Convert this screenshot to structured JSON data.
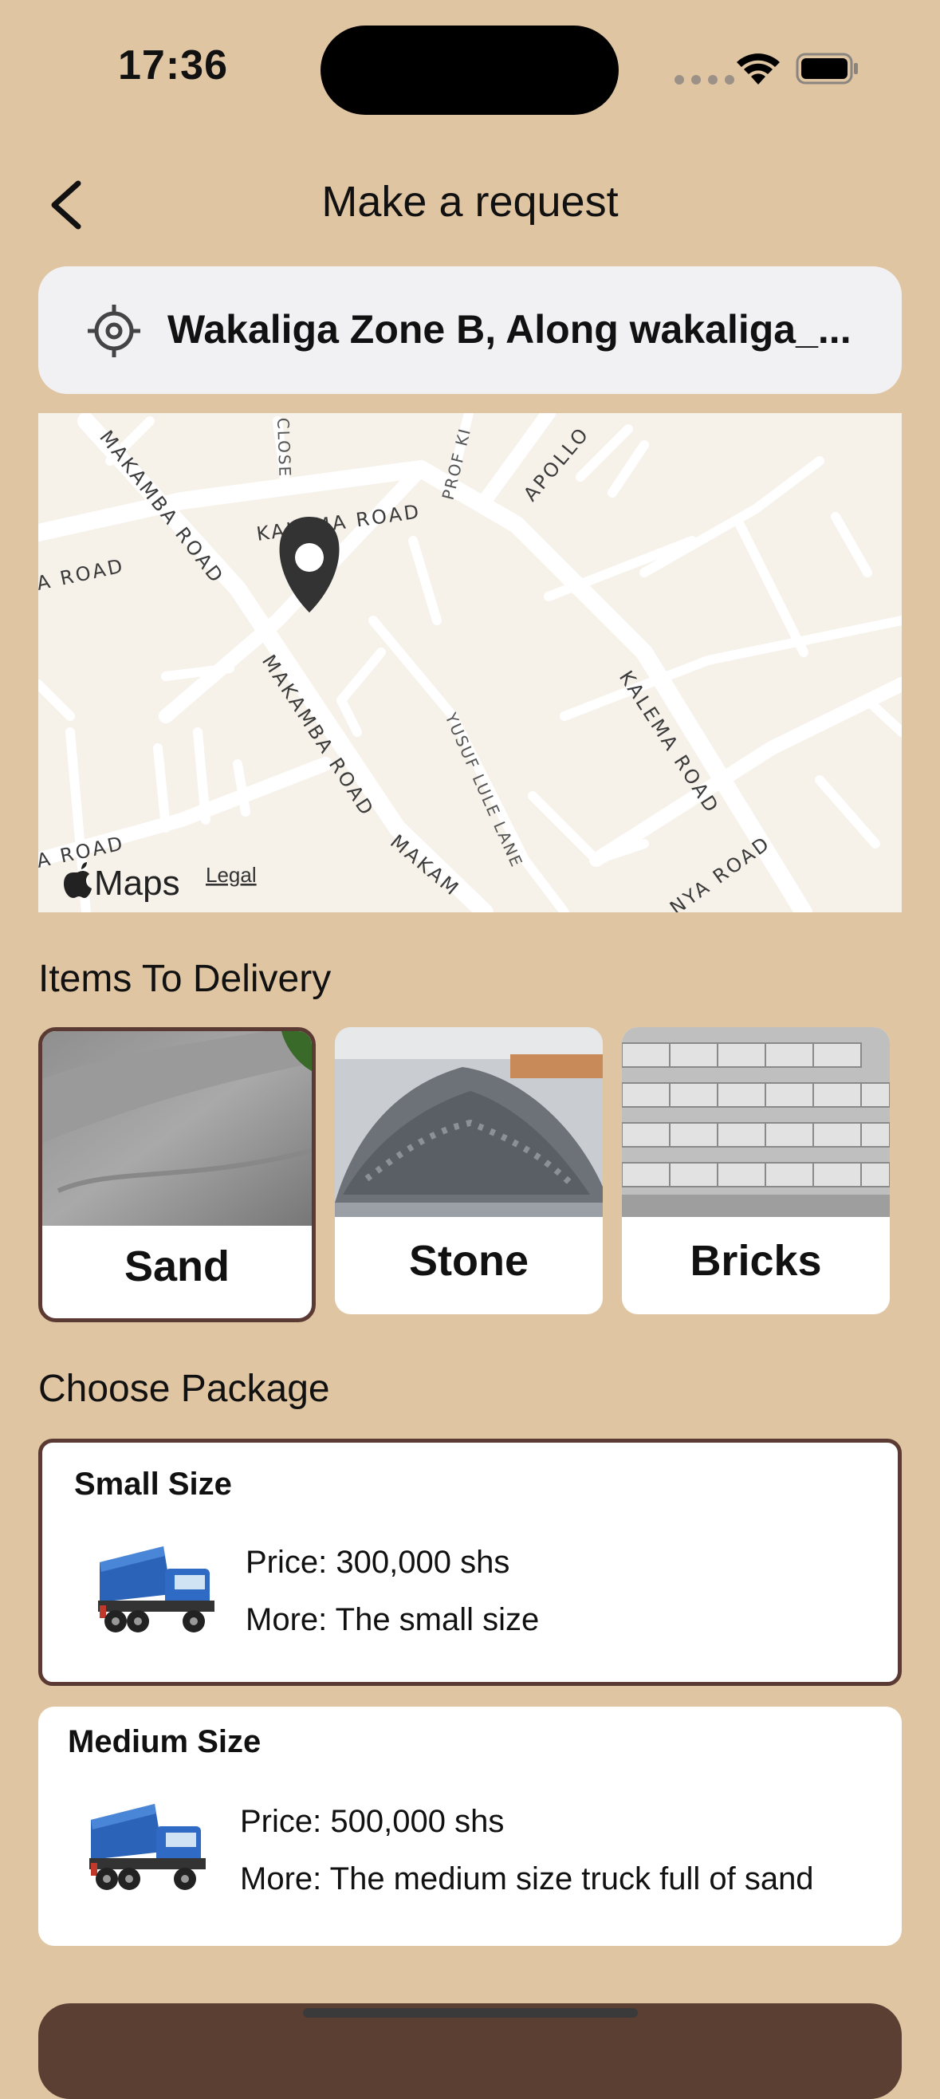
{
  "status_bar": {
    "time": "17:36"
  },
  "header": {
    "title": "Make a request"
  },
  "location": {
    "address": "Wakaliga Zone B, Along wakaliga_..."
  },
  "map": {
    "attribution": "Maps",
    "legal": "Legal",
    "road_labels": [
      "MAKAMBA ROAD",
      "KALEMA ROAD",
      "CLOSE",
      "PROF KI",
      "APOLLO",
      "MAKAMBA ROAD",
      "MAKAM",
      "YUSUF LULE LANE",
      "KALEMA ROAD",
      "NYA ROAD",
      "A ROAD",
      "A ROAD"
    ]
  },
  "items_section": {
    "title": "Items To Delivery",
    "items": [
      {
        "label": "Sand",
        "selected": true
      },
      {
        "label": "Stone",
        "selected": false
      },
      {
        "label": "Bricks",
        "selected": false
      }
    ]
  },
  "packages_section": {
    "title": "Choose Package",
    "packages": [
      {
        "title": "Small Size",
        "price_label": "Price:",
        "price": "300,000 shs",
        "more_label": "More:",
        "more": "The small size",
        "selected": true
      },
      {
        "title": "Medium Size",
        "price_label": "Price:",
        "price": "500,000 shs",
        "more_label": "More:",
        "more": "The medium size truck full of sand",
        "selected": false
      }
    ]
  },
  "colors": {
    "background": "#e0c5a2",
    "accent": "#5a3a32",
    "card": "#ffffff"
  },
  "icons": [
    "back-chevron-icon",
    "location-target-icon",
    "map-pin-icon",
    "wifi-icon",
    "battery-icon",
    "apple-icon"
  ]
}
